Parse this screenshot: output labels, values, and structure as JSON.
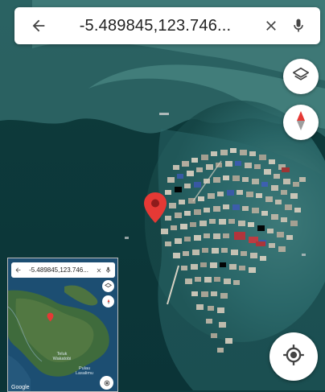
{
  "search": {
    "query": "-5.489845,123.746...",
    "back_icon": "arrow-left-icon",
    "clear_icon": "close-icon",
    "mic_icon": "microphone-icon"
  },
  "controls": {
    "layers_icon": "layers-icon",
    "compass_icon": "compass-icon",
    "location_icon": "my-location-icon"
  },
  "inset": {
    "query": "-5.489845,123.746...",
    "labels": [
      "Teluk Wakatobi",
      "Pulau Lasalimu"
    ],
    "logo": "Google"
  },
  "colors": {
    "pin": "#e53935",
    "compass_north": "#e53935",
    "water": "#0d3b3d"
  }
}
